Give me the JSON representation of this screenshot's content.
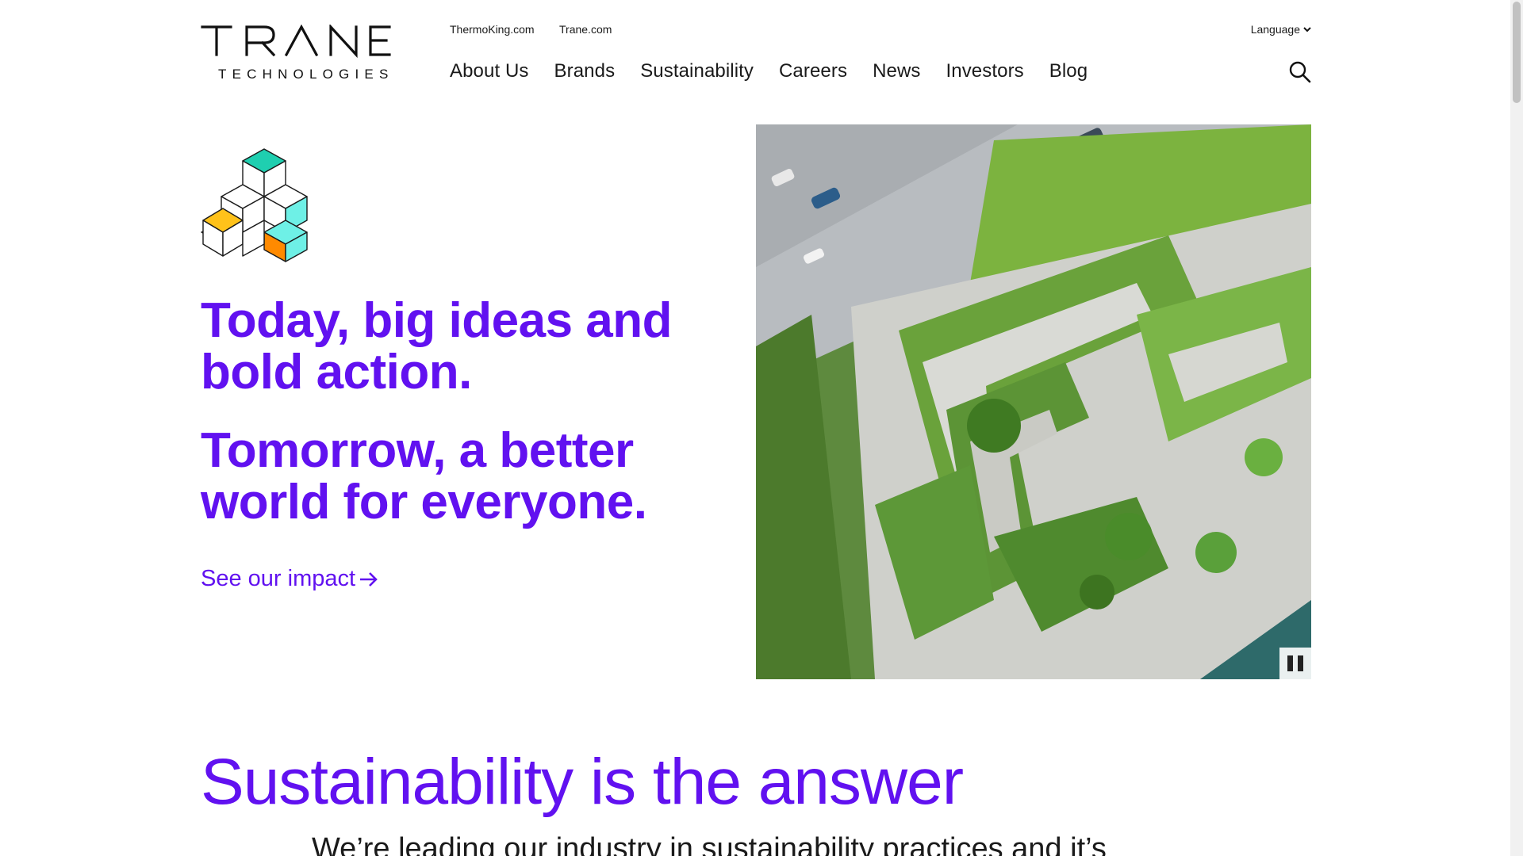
{
  "brand": {
    "name": "TRANE",
    "tagline": "TECHNOLOGIES",
    "accent_color": "#6111f0"
  },
  "header": {
    "utility_links": [
      {
        "label": "ThermoKing.com"
      },
      {
        "label": "Trane.com"
      }
    ],
    "language": {
      "label": "Language",
      "icon": "chevron-down-icon"
    },
    "nav": [
      {
        "label": "About Us"
      },
      {
        "label": "Brands"
      },
      {
        "label": "Sustainability"
      },
      {
        "label": "Careers"
      },
      {
        "label": "News"
      },
      {
        "label": "Investors"
      },
      {
        "label": "Blog"
      }
    ],
    "search_icon": "search-icon"
  },
  "hero": {
    "headline_1": "Today, big ideas and bold action.",
    "headline_2": "Tomorrow, a better world for everyone.",
    "cta_label": "See our impact",
    "cta_icon": "arrow-right-icon",
    "media": {
      "icon": "pause-icon"
    },
    "cube_colors": [
      "#1fcfb0",
      "#6ef0e6",
      "#ffc21a",
      "#ff8a00"
    ]
  },
  "sustainability": {
    "title": "Sustainability is the answer",
    "intro": "We’re leading our industry in sustainability practices and it’s"
  }
}
